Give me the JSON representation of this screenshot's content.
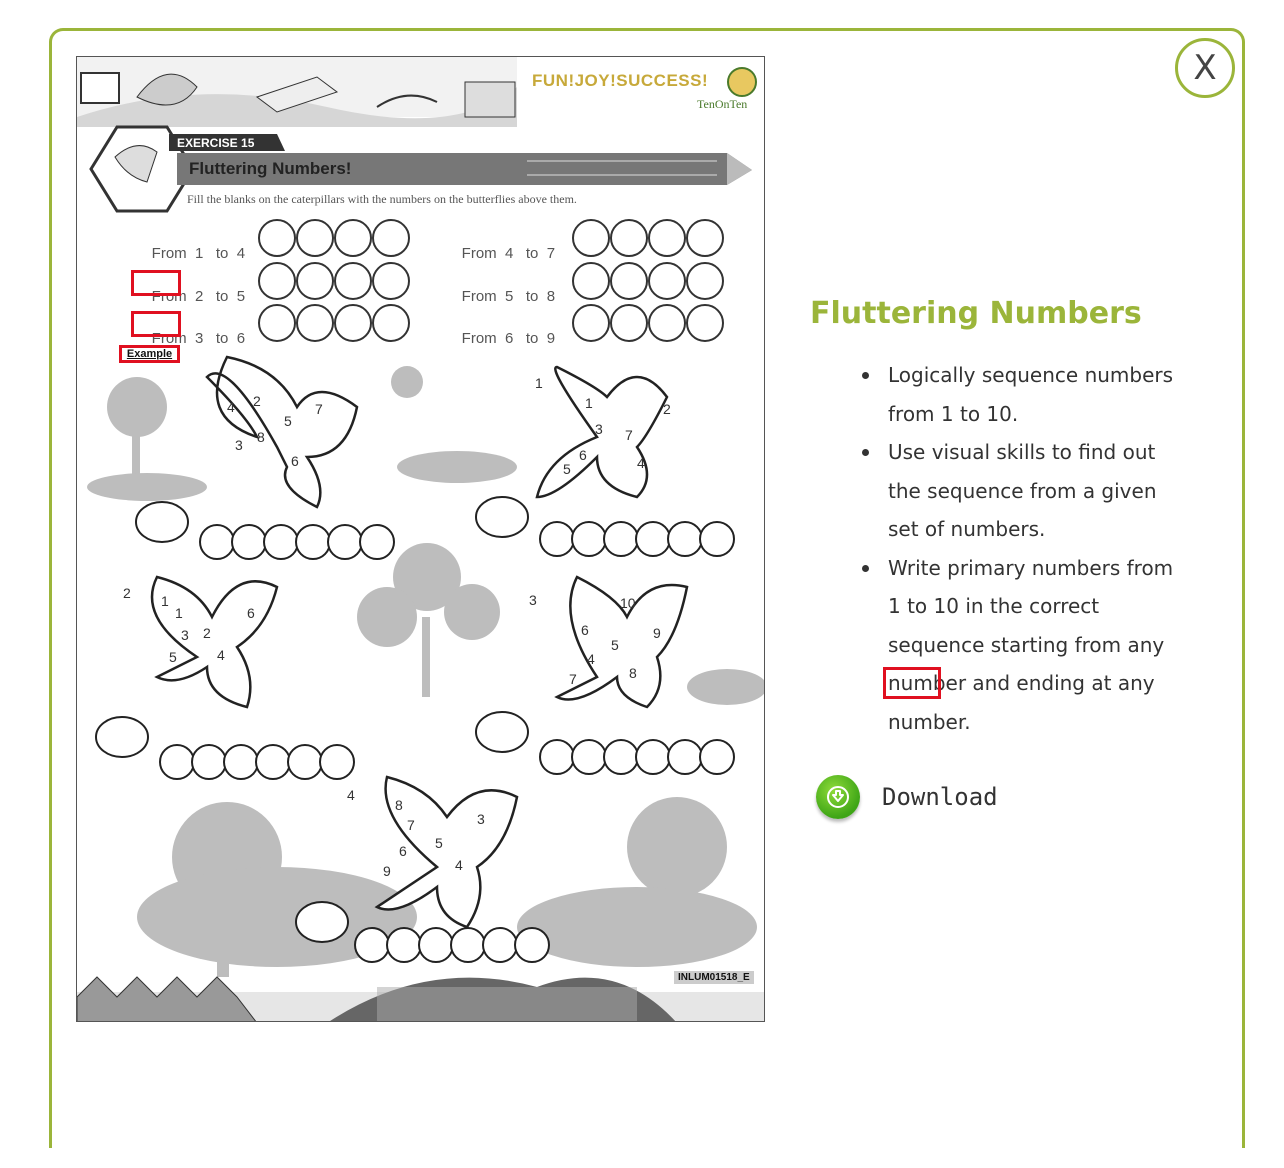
{
  "close_button": {
    "label": "X"
  },
  "worksheet": {
    "brand": "FUN!JOY!SUCCESS!",
    "brand_sub": "TenOnTen",
    "exercise_label": "EXERCISE  15",
    "title": "Fluttering Numbers!",
    "instruction": "Fill the blanks on the caterpillars with the numbers on the butterflies above them.",
    "rows_left": [
      {
        "from": "From",
        "start": "1",
        "to": "to",
        "end": "4"
      },
      {
        "from": "From",
        "start": "2",
        "to": "to",
        "end": "5"
      },
      {
        "from": "From",
        "start": "3",
        "to": "to",
        "end": "6"
      }
    ],
    "rows_right": [
      {
        "from": "From",
        "start": "4",
        "to": "to",
        "end": "7"
      },
      {
        "from": "From",
        "start": "5",
        "to": "to",
        "end": "8"
      },
      {
        "from": "From",
        "start": "6",
        "to": "to",
        "end": "9"
      }
    ],
    "example_tag": "Example",
    "butterfly_labels": [
      "1",
      "2",
      "3",
      "4"
    ],
    "butterflies": [
      {
        "numbers": [
          "4",
          "2",
          "7",
          "5",
          "3",
          "8",
          "6"
        ]
      },
      {
        "numbers": [
          "1",
          "2",
          "3",
          "7",
          "6",
          "5",
          "4"
        ]
      },
      {
        "numbers": [
          "1",
          "1",
          "6",
          "3",
          "2",
          "5",
          "4"
        ]
      },
      {
        "numbers": [
          "10",
          "6",
          "9",
          "5",
          "4",
          "7",
          "8"
        ]
      },
      {
        "numbers": [
          "8",
          "7",
          "3",
          "5",
          "6",
          "9",
          "4"
        ]
      }
    ],
    "code": "INLUM01518_E"
  },
  "panel": {
    "title": "Fluttering Numbers",
    "bullets": [
      "Logically sequence numbers from 1 to 10.",
      "Use visual skills to find out the sequence from a given set of numbers.",
      "Write primary numbers from 1 to 10 in the correct sequence starting from any number and ending at any number."
    ],
    "download_label": "Download"
  },
  "colors": {
    "accent": "#9bb53a",
    "highlight": "#e01020",
    "download": "#4cb51c"
  }
}
